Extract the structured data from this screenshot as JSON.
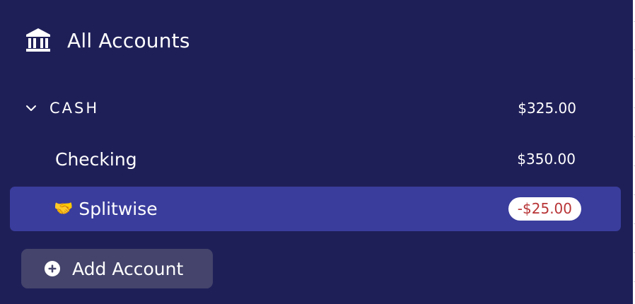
{
  "header": {
    "title": "All Accounts",
    "icon": "bank-icon"
  },
  "groups": [
    {
      "name": "CASH",
      "total": "$325.00",
      "expanded": true,
      "accounts": [
        {
          "name": "Checking",
          "balance": "$350.00",
          "selected": false
        },
        {
          "name": "Splitwise",
          "emoji": "🤝",
          "balance": "-$25.00",
          "selected": true
        }
      ]
    }
  ],
  "add_account": {
    "label": "Add Account",
    "icon": "plus-circle-icon"
  },
  "colors": {
    "sidebar_bg": "#1f1f58",
    "selected_bg": "#3a3d9c",
    "button_bg": "#44446c",
    "negative_text": "#b83436"
  }
}
